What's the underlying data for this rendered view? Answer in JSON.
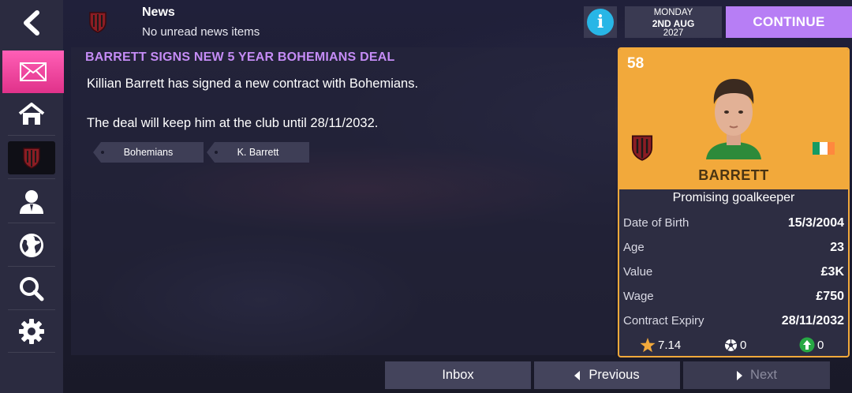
{
  "header": {
    "section_title": "News",
    "section_subtitle": "No unread news items",
    "date": {
      "weekday": "MONDAY",
      "day_month": "2ND AUG",
      "year": "2027"
    },
    "continue_label": "CONTINUE"
  },
  "sidebar": {
    "items": [
      {
        "name": "back",
        "icon": "back-arrow-icon"
      },
      {
        "name": "inbox",
        "icon": "mail-icon",
        "active": true
      },
      {
        "name": "home",
        "icon": "home-icon"
      },
      {
        "name": "club",
        "icon": "club-shield-icon"
      },
      {
        "name": "staff",
        "icon": "person-icon"
      },
      {
        "name": "world",
        "icon": "globe-icon"
      },
      {
        "name": "search",
        "icon": "search-icon"
      },
      {
        "name": "settings",
        "icon": "gear-icon"
      }
    ]
  },
  "news": {
    "headline": "BARRETT SIGNS NEW 5 YEAR BOHEMIANS DEAL",
    "body_line1": "Killian Barrett has signed a new contract with Bohemians.",
    "body_line2": "The deal will keep him at the club until 28/11/2032.",
    "tags": [
      "Bohemians",
      "K. Barrett"
    ]
  },
  "player_card": {
    "rating": "58",
    "name": "BARRETT",
    "role": "Promising goalkeeper",
    "stats": [
      {
        "label": "Date of Birth",
        "value": "15/3/2004"
      },
      {
        "label": "Age",
        "value": "23"
      },
      {
        "label": "Value",
        "value": "£3K"
      },
      {
        "label": "Wage",
        "value": "£750"
      },
      {
        "label": "Contract Expiry",
        "value": "28/11/2032"
      }
    ],
    "footer": {
      "avg_rating": "7.14",
      "goals": "0",
      "assists": "0"
    },
    "nationality_flag_colors": [
      "#169b62",
      "#ffffff",
      "#ff883e"
    ]
  },
  "bottom_nav": {
    "inbox": "Inbox",
    "previous": "Previous",
    "next": "Next"
  },
  "colors": {
    "accent_purple": "#b77ef5",
    "headline_purple": "#c58cf6",
    "active_pink": "#ff5fb6",
    "card_gold": "#f2a93b",
    "info_blue": "#28b6e6",
    "club_red": "#8b1d24"
  }
}
